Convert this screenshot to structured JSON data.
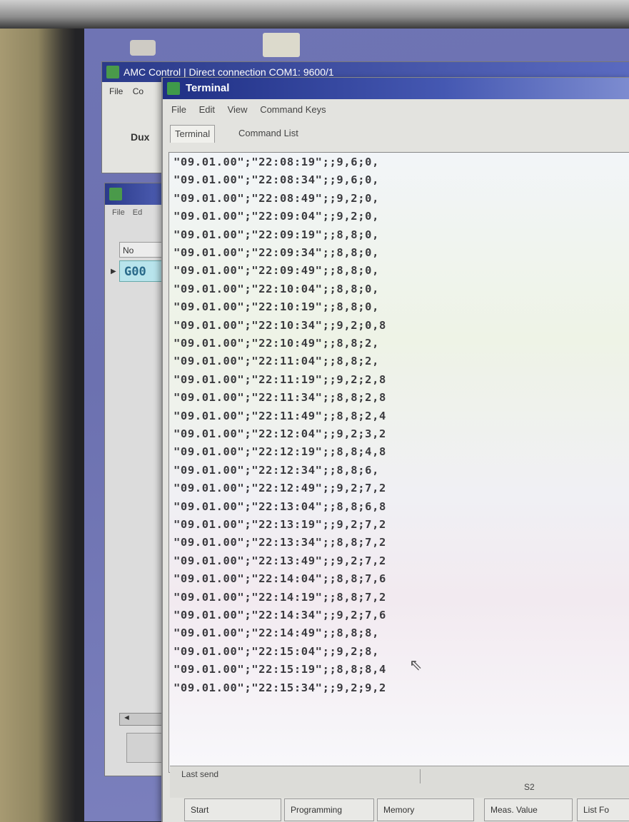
{
  "back_window": {
    "title": "AMC Control | Direct connection COM1: 9600/1",
    "menu": [
      "File",
      "Co"
    ],
    "label": "Dux"
  },
  "list_window": {
    "menu": [
      "File",
      "Ed"
    ],
    "column_header": "No",
    "row_value": "G00",
    "scroll_arrow": "◄"
  },
  "terminal": {
    "title": "Terminal",
    "menu": [
      "File",
      "Edit",
      "View",
      "Command Keys"
    ],
    "tabs": [
      "Terminal",
      "Command List"
    ],
    "lines": [
      "\"09.01.00\";\"22:08:19\";;9,6;0,",
      "\"09.01.00\";\"22:08:34\";;9,6;0,",
      "\"09.01.00\";\"22:08:49\";;9,2;0,",
      "\"09.01.00\";\"22:09:04\";;9,2;0,",
      "\"09.01.00\";\"22:09:19\";;8,8;0,",
      "\"09.01.00\";\"22:09:34\";;8,8;0,",
      "\"09.01.00\";\"22:09:49\";;8,8;0,",
      "\"09.01.00\";\"22:10:04\";;8,8;0,",
      "\"09.01.00\";\"22:10:19\";;8,8;0,",
      "\"09.01.00\";\"22:10:34\";;9,2;0,8",
      "\"09.01.00\";\"22:10:49\";;8,8;2,",
      "\"09.01.00\";\"22:11:04\";;8,8;2,",
      "\"09.01.00\";\"22:11:19\";;9,2;2,8",
      "\"09.01.00\";\"22:11:34\";;8,8;2,8",
      "\"09.01.00\";\"22:11:49\";;8,8;2,4",
      "\"09.01.00\";\"22:12:04\";;9,2;3,2",
      "\"09.01.00\";\"22:12:19\";;8,8;4,8",
      "\"09.01.00\";\"22:12:34\";;8,8;6,",
      "\"09.01.00\";\"22:12:49\";;9,2;7,2",
      "\"09.01.00\";\"22:13:04\";;8,8;6,8",
      "\"09.01.00\";\"22:13:19\";;9,2;7,2",
      "\"09.01.00\";\"22:13:34\";;8,8;7,2",
      "\"09.01.00\";\"22:13:49\";;9,2;7,2",
      "\"09.01.00\";\"22:14:04\";;8,8;7,6",
      "\"09.01.00\";\"22:14:19\";;8,8;7,2",
      "\"09.01.00\";\"22:14:34\";;9,2;7,6",
      "\"09.01.00\";\"22:14:49\";;8,8;8,",
      "\"09.01.00\";\"22:15:04\";;9,2;8,",
      "\"09.01.00\";\"22:15:19\";;8,8;8,4",
      "\"09.01.00\";\"22:15:34\";;9,2;9,2"
    ],
    "status": {
      "last_send_label": "Last send",
      "value": "S2"
    },
    "buttons": [
      "Start",
      "Programming",
      "Memory",
      "Meas. Value",
      "List Fo"
    ]
  },
  "colors": {
    "titlebar": "#2a3a8a",
    "desktop": "#6f74b4",
    "selected_row": "#b8e4ec"
  }
}
